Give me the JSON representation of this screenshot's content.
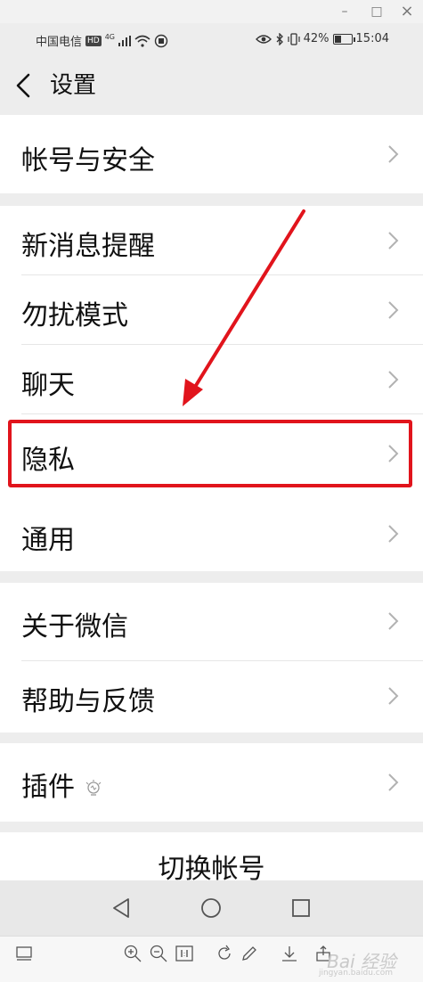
{
  "window": {
    "minimize_glyph": "–",
    "restore_glyph": "□",
    "close_glyph": "×"
  },
  "status_bar": {
    "carrier": "中国电信",
    "hd_badge": "HD",
    "network_type": "4G",
    "battery_percent_text": "42%",
    "battery_level": 0.42,
    "time": "15:04",
    "icons": [
      "signal-icon",
      "wifi-icon",
      "notification-icon",
      "eye-icon",
      "bluetooth-icon",
      "vibrate-icon",
      "battery-icon"
    ]
  },
  "nav": {
    "title": "设置"
  },
  "menu": {
    "account_security": "帐号与安全",
    "new_message_alert": "新消息提醒",
    "do_not_disturb": "勿扰模式",
    "chat": "聊天",
    "privacy": "隐私",
    "general": "通用",
    "about_wechat": "关于微信",
    "help_feedback": "帮助与反馈",
    "plugins": "插件"
  },
  "switch_account": "切换帐号",
  "annotation": {
    "highlight_color": "#e1141c",
    "highlighted_item": "隐私"
  },
  "watermark": {
    "text": "Bai 经验",
    "sub": "jingyan.baidu.com"
  },
  "colors": {
    "page_bg": "#ededed",
    "item_bg": "#ffffff",
    "text": "#111111",
    "chevron": "#b2b2b2"
  }
}
